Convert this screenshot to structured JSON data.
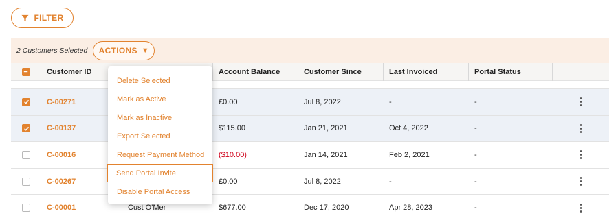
{
  "filter": {
    "label": "FILTER",
    "icon": "filter-icon"
  },
  "selection": {
    "count_text": "2 Customers Selected",
    "actions_label": "ACTIONS",
    "actions_caret": "▼"
  },
  "table": {
    "columns": [
      "Customer ID",
      "",
      "Account Balance",
      "Customer Since",
      "Last Invoiced",
      "Portal Status"
    ],
    "rows": [
      {
        "checked": true,
        "id": "C-00271",
        "name": "",
        "balance": "£0.00",
        "since": "Jul 8, 2022",
        "invoiced": "-",
        "portal": "-"
      },
      {
        "checked": true,
        "id": "C-00137",
        "name": "",
        "balance": "$115.00",
        "since": "Jan 21, 2021",
        "invoiced": "Oct 4, 2022",
        "portal": "-"
      },
      {
        "checked": false,
        "id": "C-00016",
        "name": "",
        "balance": "($10.00)",
        "since": "Jan 14, 2021",
        "invoiced": "Feb 2, 2021",
        "portal": "-"
      },
      {
        "checked": false,
        "id": "C-00267",
        "name": "",
        "balance": "£0.00",
        "since": "Jul 8, 2022",
        "invoiced": "-",
        "portal": "-"
      },
      {
        "checked": false,
        "id": "C-00001",
        "name": "Cust O'Mer",
        "balance": "$677.00",
        "since": "Dec 17, 2020",
        "invoiced": "Apr 28, 2023",
        "portal": "-"
      }
    ],
    "row_menu_glyph": "⋮"
  },
  "actions_menu": {
    "items": [
      "Delete Selected",
      "Mark as Active",
      "Mark as Inactive",
      "Export Selected",
      "Request Payment Method",
      "Send Portal Invite",
      "Disable Portal Access"
    ],
    "focused": "Send Portal Invite"
  },
  "colors": {
    "accent": "#e2832f",
    "selected_row": "#edf1f7",
    "selection_bar": "#fbeee4",
    "negative": "#d0021b"
  }
}
